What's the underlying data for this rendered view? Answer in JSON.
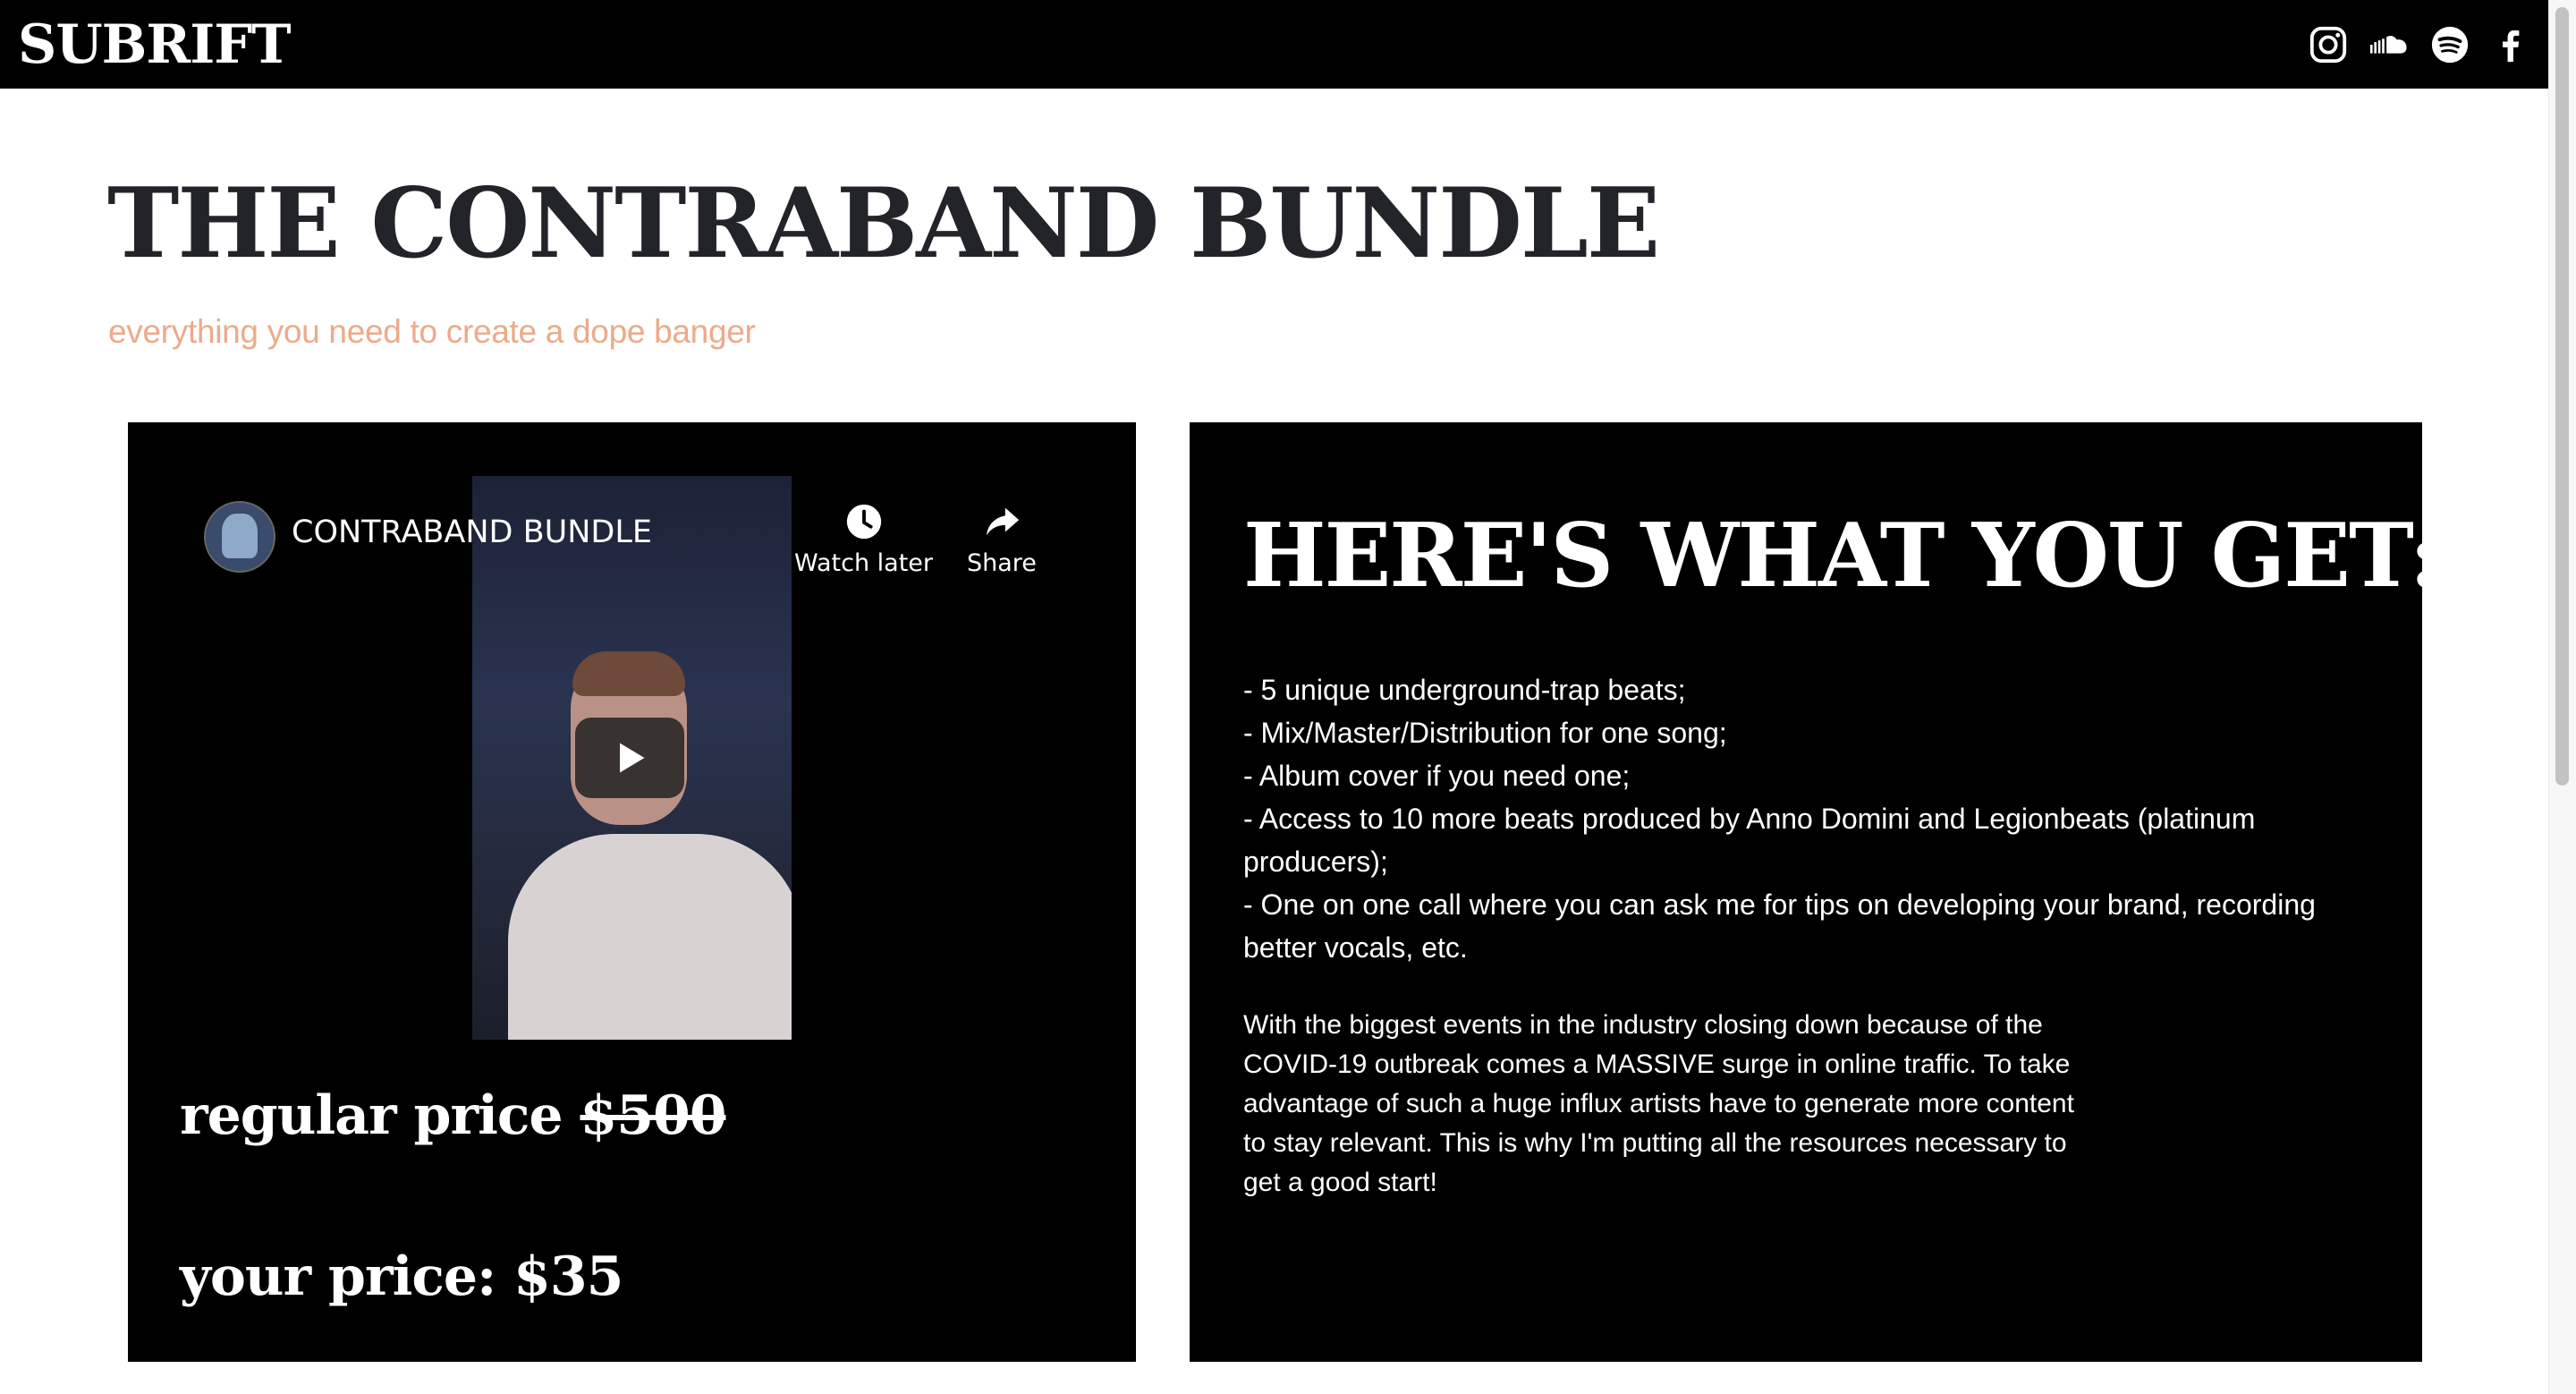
{
  "header": {
    "logo": "SUBRIFT",
    "social_icons": [
      "instagram-icon",
      "soundcloud-icon",
      "spotify-icon",
      "facebook-icon"
    ]
  },
  "page": {
    "title": "THE CONTRABAND BUNDLE",
    "subtitle": "everything you need to create a dope banger"
  },
  "video": {
    "channel_title": "CONTRABAND BUNDLE",
    "watch_later_label": "Watch later",
    "share_label": "Share"
  },
  "pricing": {
    "regular_label": "regular price ",
    "regular_amount": "$500",
    "your_price": "your price: $35"
  },
  "offer": {
    "title": "HERE'S WHAT YOU GET:",
    "items": [
      "- 5 unique underground-trap beats;",
      "- Mix/Master/Distribution for one song;",
      "- Album cover if you need one;",
      "- Access to 10 more beats produced by Anno Domini and Legionbeats (platinum producers);",
      "- One on one call where you can ask me for tips on developing your brand, recording better vocals, etc."
    ],
    "paragraph": "With the biggest events in the industry closing down because of the COVID-19 outbreak comes a MASSIVE surge in online traffic. To take advantage of such a huge influx artists have to generate more content to stay relevant. This is why I'm putting all the resources necessary to get a good start!"
  },
  "colors": {
    "header_bg": "#000000",
    "title_text": "#222429",
    "subtitle_accent": "#ecaa8a",
    "card_bg": "#000000"
  }
}
